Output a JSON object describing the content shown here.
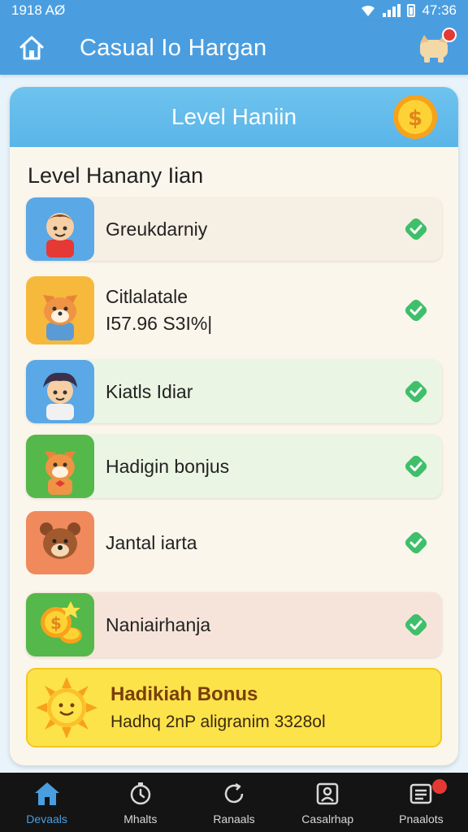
{
  "status_bar": {
    "left": "1918 AØ",
    "right": "47:36"
  },
  "app_bar": {
    "title": "Casual Io Hargan"
  },
  "card": {
    "header_title": "Level Haniin",
    "section_title": "Level Hanany Iian"
  },
  "items": [
    {
      "name": "Greukdarniy",
      "sub": "",
      "bg": "#f6efe4",
      "avatar_bg": "#5aa8e6",
      "completed": true
    },
    {
      "name": "Citlalatale",
      "sub": "I57.96 S3I%|",
      "bg": "#fbf6ec",
      "avatar_bg": "#f6b93b",
      "completed": true
    },
    {
      "name": "Kiatls Idiar",
      "sub": "",
      "bg": "#eaf5e4",
      "avatar_bg": "#5aa8e6",
      "completed": true
    },
    {
      "name": "Hadigin bonjus",
      "sub": "",
      "bg": "#eaf5e4",
      "avatar_bg": "#55b84a",
      "completed": true
    },
    {
      "name": "Jantal iarta",
      "sub": "",
      "bg": "#fbf6ec",
      "avatar_bg": "#f08a5d",
      "completed": true
    },
    {
      "name": "Naniairhanja",
      "sub": "",
      "bg": "#f6e4da",
      "avatar_bg": "#55b84a",
      "completed": true
    }
  ],
  "bonus": {
    "title": "Hadikiah Bonus",
    "sub": "Hadhq 2nP aligranim 3328ol"
  },
  "bottom_nav": [
    {
      "label": "Devaals",
      "icon": "home-icon",
      "active": true
    },
    {
      "label": "Mhalts",
      "icon": "timer-icon",
      "active": false
    },
    {
      "label": "Ranaals",
      "icon": "refresh-icon",
      "active": false
    },
    {
      "label": "Casalrhap",
      "icon": "profile-card-icon",
      "active": false
    },
    {
      "label": "Pnaalots",
      "icon": "list-icon",
      "active": false,
      "badge": true
    }
  ],
  "colors": {
    "primary": "#4a9ee0",
    "check": "#3fbf6a",
    "bonus": "#fde34a"
  }
}
